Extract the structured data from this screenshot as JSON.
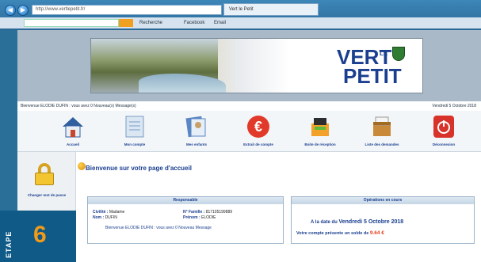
{
  "browser": {
    "address": "http://www.vertlepetit.fr/",
    "tab": "Vert le Petit",
    "toolbar": [
      "Recherche",
      "Facebook",
      "Email"
    ]
  },
  "banner": {
    "brand_line1": "VERT",
    "brand_le": "LE",
    "brand_line2": "PETIT"
  },
  "welcome": {
    "left": "Bienvenue ELODIE DUFIN : vous avez 0 Nouveau(x) Message(s)",
    "right": "Vendredi 5 Octobre 2018"
  },
  "menu": [
    {
      "label": "Accueil",
      "icon": "home-icon",
      "color": "#4a7fc0"
    },
    {
      "label": "Mon compte",
      "icon": "account-icon",
      "color": "#8fb1d8"
    },
    {
      "label": "Mes enfants",
      "icon": "children-icon",
      "color": "#5b86c4"
    },
    {
      "label": "Extrait de compte",
      "icon": "euro-icon",
      "color": "#e23a2a"
    },
    {
      "label": "Boite de réception",
      "icon": "inbox-icon",
      "color": "#f2a12a"
    },
    {
      "label": "Liste des demandes",
      "icon": "requests-icon",
      "color": "#c88a3a"
    },
    {
      "label": "Déconnexion",
      "icon": "power-icon",
      "color": "#d8332a"
    }
  ],
  "left_panel": {
    "label": "Changer mot de passe"
  },
  "main": {
    "title": "Bienvenue sur votre page d'accueil"
  },
  "responsable": {
    "heading": "Responsable",
    "civilite_label": "Civilité :",
    "civilite": "Madame",
    "nom_label": "Nom :",
    "nom": "DUFIN",
    "famille_label": "N° Famille :",
    "famille": "817105199889",
    "prenom_label": "Prénom :",
    "prenom": "ELODIE",
    "message": "Bienvenue ELODIE DUFIN : vous avez 0 Nouveau Message"
  },
  "operations": {
    "heading": "Opérations en cours",
    "date_prefix": "A la date du",
    "date": "Vendredi 5 Octobre 2018",
    "balance_text": "Votre compte présente un solde de",
    "amount": "9.64 €"
  },
  "step": {
    "label": "ETAPE",
    "number": "6"
  }
}
